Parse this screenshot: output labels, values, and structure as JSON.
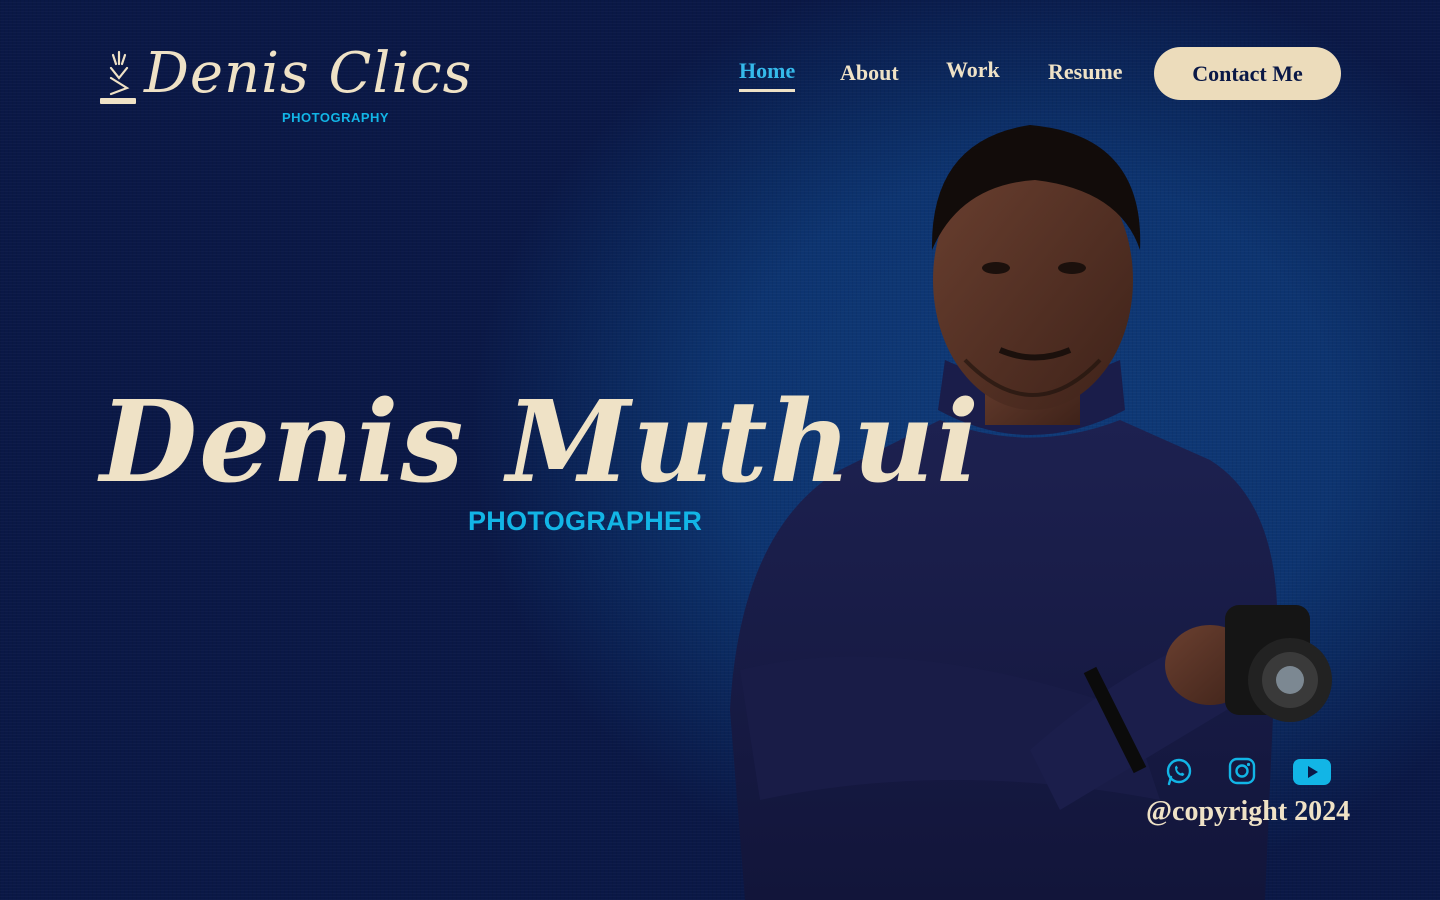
{
  "brand": {
    "script_name": "Denis Clics",
    "tagline": "PHOTOGRAPHY"
  },
  "nav": {
    "items": [
      {
        "label": "Home",
        "active": true
      },
      {
        "label": "About",
        "active": false
      },
      {
        "label": "Work",
        "active": false
      },
      {
        "label": "Resume",
        "active": false
      }
    ],
    "contact_label": "Contact Me"
  },
  "hero": {
    "name": "Denis Muthui",
    "role": "PHOTOGRAPHER"
  },
  "social": {
    "icons": [
      "whatsapp-icon",
      "instagram-icon",
      "youtube-icon"
    ]
  },
  "footer": {
    "copyright": "@copyright 2024"
  },
  "colors": {
    "background": "#0a1846",
    "spotlight": "#0f3a78",
    "cream": "#efe2c6",
    "accent_blue": "#12b5e6",
    "button_bg": "#ecdcbb"
  }
}
